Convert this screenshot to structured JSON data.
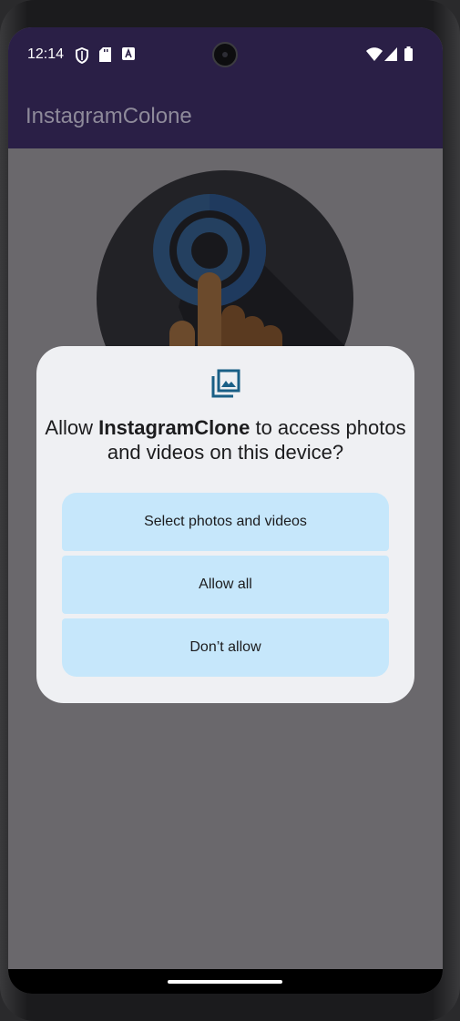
{
  "status_bar": {
    "time": "12:14",
    "left_icons": [
      "shield-icon",
      "sd-card-icon",
      "font-a-icon"
    ],
    "right_icons": [
      "wifi-icon",
      "signal-icon",
      "battery-icon"
    ]
  },
  "app_bar": {
    "title": "InstagramColone"
  },
  "dialog": {
    "icon": "photo-library-icon",
    "title_prefix": "Allow ",
    "title_app": "InstagramClone",
    "title_suffix": " to access photos and videos on this device?",
    "buttons": {
      "select": "Select photos and videos",
      "allow_all": "Allow all",
      "dont_allow": "Don’t allow"
    }
  },
  "colors": {
    "app_bar": "#2a1f46",
    "scrim": "#6a686c",
    "dialog_bg": "#eff0f3",
    "button_bg": "#c6e7fb",
    "icon_accent": "#1a5f86"
  }
}
